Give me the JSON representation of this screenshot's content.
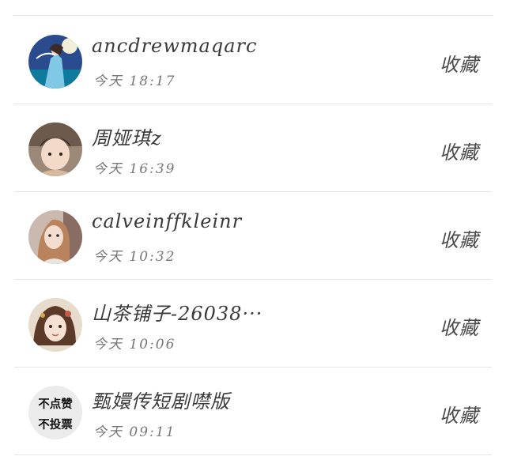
{
  "items": [
    {
      "name": "ancdrewmaqarc",
      "time": "今天 18:17",
      "action": "收藏"
    },
    {
      "name": "周娅琪z",
      "time": "今天 16:39",
      "action": "收藏"
    },
    {
      "name": "calveinffkleinr",
      "time": "今天 10:32",
      "action": "收藏"
    },
    {
      "name": "山茶铺子-26038···",
      "time": "今天 10:06",
      "action": "收藏"
    },
    {
      "name": "甄嬛传短剧噤版",
      "time": "今天 09:11",
      "action": "收藏",
      "avatar_text": [
        "不点赞",
        "不投票"
      ]
    }
  ]
}
